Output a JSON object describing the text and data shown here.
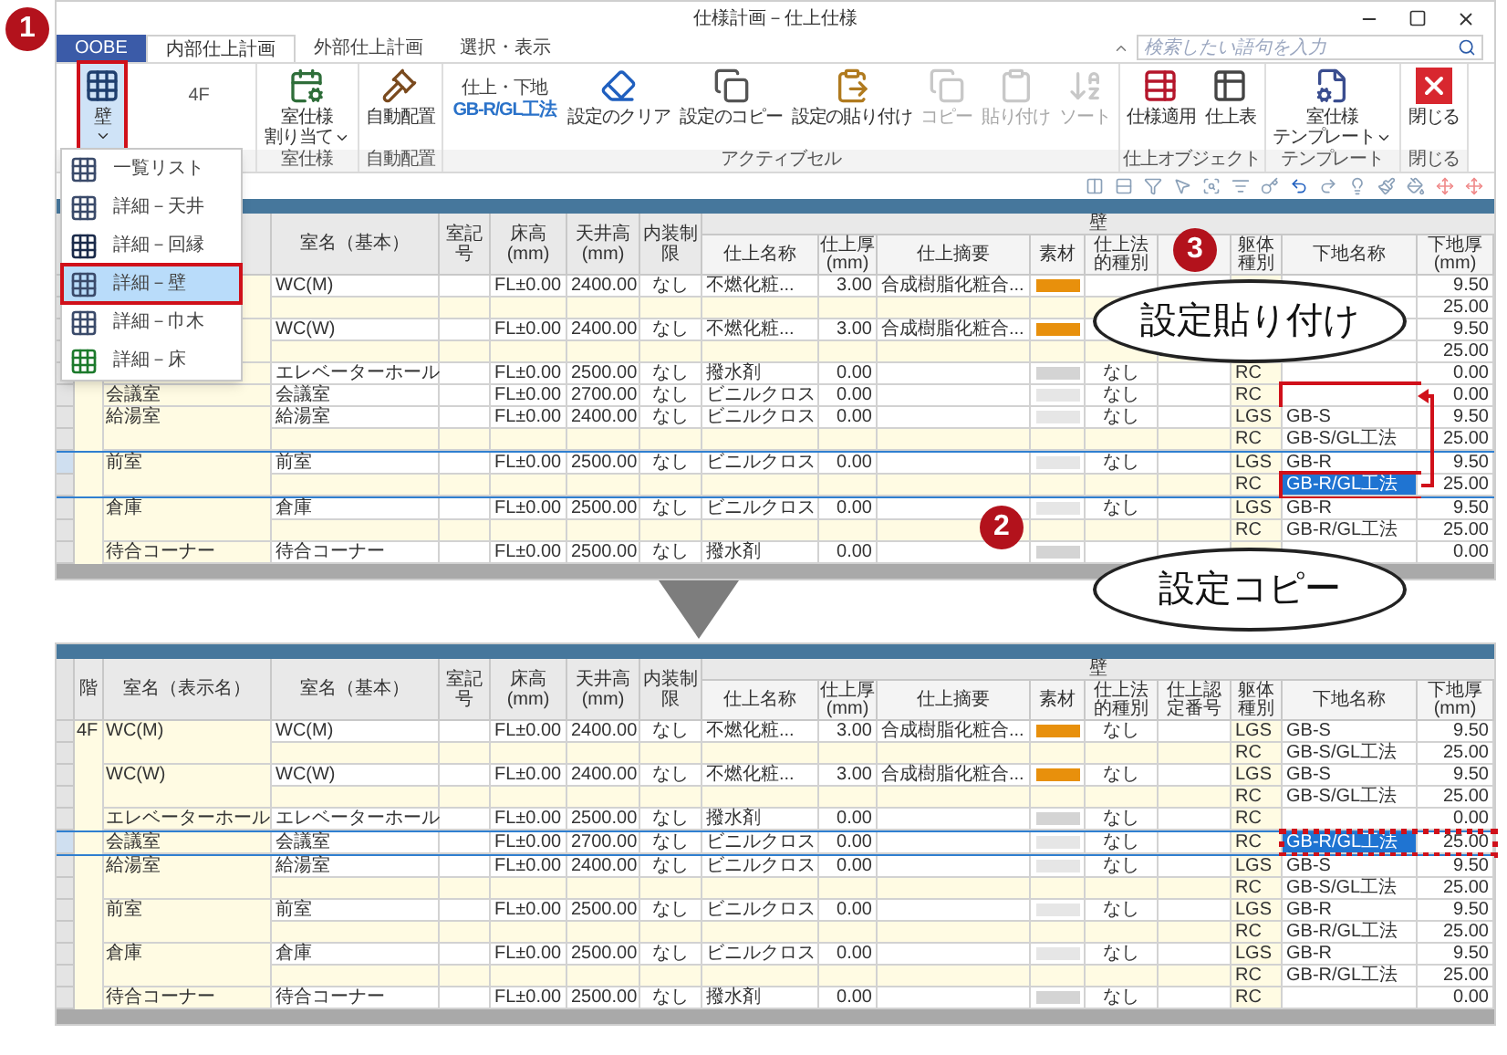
{
  "window": {
    "title": "仕様計画－仕上仕様",
    "search": {
      "placeholder": "検索したい語句を入力"
    }
  },
  "tabs": [
    {
      "label": "OOBE",
      "kind": "file",
      "selected": false
    },
    {
      "label": "内部仕上計画",
      "kind": "tab",
      "selected": true
    },
    {
      "label": "外部仕上計画",
      "kind": "tab",
      "selected": false
    },
    {
      "label": "選択・表示",
      "kind": "tab",
      "selected": false
    }
  ],
  "ribbon": {
    "groups": [
      {
        "items": [
          {
            "kind": "button",
            "lines": [
              "壁"
            ],
            "dropdown": true,
            "disabled": false,
            "pressed": true,
            "boxed": true
          },
          {
            "kind": "floor",
            "label": "4F"
          }
        ]
      },
      {
        "label": "室仕様",
        "items": [
          {
            "kind": "button",
            "lines": [
              "室仕様",
              "割り当て"
            ],
            "dropdown": true,
            "disabled": false,
            "pressed": false
          }
        ]
      },
      {
        "label": "自動配置",
        "items": [
          {
            "kind": "button",
            "lines": [
              "自動配置"
            ],
            "dropdown": false,
            "disabled": false,
            "pressed": false
          }
        ]
      },
      {
        "label": "アクティブセル",
        "items": [
          {
            "kind": "finish",
            "label": "仕上・下地",
            "value": "GB-R/GL工法"
          },
          {
            "kind": "button",
            "lines": [
              "設定のクリア"
            ],
            "dropdown": false,
            "disabled": false,
            "pressed": false
          },
          {
            "kind": "button",
            "lines": [
              "設定のコピー"
            ],
            "dropdown": false,
            "disabled": false,
            "pressed": false
          },
          {
            "kind": "button",
            "lines": [
              "設定の貼り付け"
            ],
            "dropdown": false,
            "disabled": false,
            "pressed": false
          },
          {
            "kind": "button",
            "lines": [
              "コピー"
            ],
            "dropdown": false,
            "disabled": true,
            "pressed": false
          },
          {
            "kind": "button",
            "lines": [
              "貼り付け"
            ],
            "dropdown": false,
            "disabled": true,
            "pressed": false
          },
          {
            "kind": "button",
            "lines": [
              "ソート"
            ],
            "dropdown": false,
            "disabled": true,
            "pressed": false
          }
        ]
      },
      {
        "label": "仕上オブジェクト",
        "items": [
          {
            "kind": "button",
            "lines": [
              "仕様適用"
            ],
            "dropdown": false,
            "disabled": false,
            "pressed": false
          },
          {
            "kind": "button",
            "lines": [
              "仕上表"
            ],
            "dropdown": false,
            "disabled": false,
            "pressed": false
          }
        ]
      },
      {
        "label": "テンプレート",
        "items": [
          {
            "kind": "button",
            "lines": [
              "室仕様",
              "テンプレート"
            ],
            "dropdown": true,
            "disabled": false,
            "pressed": false
          }
        ]
      },
      {
        "label": "閉じる",
        "items": [
          {
            "kind": "button",
            "lines": [
              "閉じる"
            ],
            "dropdown": false,
            "disabled": false,
            "pressed": false
          }
        ]
      }
    ]
  },
  "menu": {
    "items": [
      {
        "label": "一覧リスト",
        "selected": false
      },
      {
        "label": "詳細－天井",
        "selected": false
      },
      {
        "label": "詳細－回縁",
        "selected": false
      },
      {
        "label": "詳細－壁",
        "selected": true,
        "boxed": true
      },
      {
        "label": "詳細－巾木",
        "selected": false
      },
      {
        "label": "詳細－床",
        "selected": false
      }
    ]
  },
  "callouts": [
    {
      "number": "1"
    },
    {
      "number": "3",
      "text": "設定貼り付け"
    },
    {
      "number": "2",
      "text": "設定コピー"
    }
  ],
  "tables": [
    {
      "group_header": "壁",
      "columns": [
        null,
        null,
        "室名（基本）",
        "室記号",
        "床高(mm)",
        "天井高(mm)",
        "内装制限",
        "仕上名称",
        "仕上厚(mm)",
        "仕上摘要",
        "素材",
        "仕上法的種別",
        null,
        "躯体種別",
        "下地名称",
        "下地厚(mm)"
      ],
      "rooms": [
        {
          "base": "WC(M)",
          "floor_h": "FL±0.00",
          "ceiling": "2400.00",
          "limit": "なし",
          "finish": "不燃化粧...",
          "thick": "3.00",
          "summary": "合成樹脂化粧合...",
          "color": "#e8900c",
          "selected": false,
          "layers": [
            {
              "thick": "9.50",
              "selected": false
            },
            {
              "thick": "25.00",
              "selected": false
            }
          ]
        },
        {
          "base": "WC(W)",
          "floor_h": "FL±0.00",
          "ceiling": "2400.00",
          "limit": "なし",
          "finish": "不燃化粧...",
          "thick": "3.00",
          "summary": "合成樹脂化粧合...",
          "color": "#e8900c",
          "selected": false,
          "layers": [
            {
              "thick": "9.50",
              "selected": false
            },
            {
              "thick": "25.00",
              "selected": false
            }
          ]
        },
        {
          "base": "エレベーターホール",
          "floor_h": "FL±0.00",
          "ceiling": "2500.00",
          "limit": "なし",
          "finish": "撥水剤",
          "thick": "0.00",
          "color": "#d4d4d4",
          "legal": "なし",
          "selected": false,
          "layers": [
            {
              "frame": "RC",
              "thick": "0.00",
              "selected": false
            }
          ]
        },
        {
          "display": "会議室",
          "base": "会議室",
          "floor_h": "FL±0.00",
          "ceiling": "2700.00",
          "limit": "なし",
          "finish": "ビニルクロス",
          "thick": "0.00",
          "color": "#e6e6e6",
          "legal": "なし",
          "selected": false,
          "layers": [
            {
              "frame": "RC",
              "thick": "0.00",
              "selected": false,
              "boxed": true
            }
          ]
        },
        {
          "display": "給湯室",
          "base": "給湯室",
          "floor_h": "FL±0.00",
          "ceiling": "2400.00",
          "limit": "なし",
          "finish": "ビニルクロス",
          "thick": "0.00",
          "color": "#e6e6e6",
          "legal": "なし",
          "selected": false,
          "layers": [
            {
              "frame": "LGS",
              "name": "GB-S",
              "thick": "9.50",
              "selected": false
            },
            {
              "frame": "RC",
              "name": "GB-S/GL工法",
              "thick": "25.00",
              "selected": false
            }
          ]
        },
        {
          "display": "前室",
          "base": "前室",
          "floor_h": "FL±0.00",
          "ceiling": "2500.00",
          "limit": "なし",
          "finish": "ビニルクロス",
          "thick": "0.00",
          "color": "#e6e6e6",
          "legal": "なし",
          "selected": true,
          "layers": [
            {
              "frame": "LGS",
              "name": "GB-R",
              "thick": "9.50",
              "selected": false
            },
            {
              "frame": "RC",
              "name": "GB-R/GL工法",
              "thick": "25.00",
              "selected": true,
              "boxed": true
            }
          ]
        },
        {
          "display": "倉庫",
          "base": "倉庫",
          "floor_h": "FL±0.00",
          "ceiling": "2500.00",
          "limit": "なし",
          "finish": "ビニルクロス",
          "thick": "0.00",
          "color": "#e6e6e6",
          "legal": "なし",
          "selected": false,
          "layers": [
            {
              "frame": "LGS",
              "name": "GB-R",
              "thick": "9.50",
              "selected": false
            },
            {
              "frame": "RC",
              "name": "GB-R/GL工法",
              "thick": "25.00",
              "selected": false
            }
          ]
        },
        {
          "display": "待合コーナー",
          "base": "待合コーナー",
          "floor_h": "FL±0.00",
          "ceiling": "2500.00",
          "limit": "なし",
          "finish": "撥水剤",
          "thick": "0.00",
          "color": "#d4d4d4",
          "selected": false,
          "layers": [
            {
              "thick": "0.00",
              "selected": false
            }
          ]
        }
      ]
    },
    {
      "group_header": "壁",
      "columns": [
        "階",
        "室名（表示名）",
        "室名（基本）",
        "室記号",
        "床高(mm)",
        "天井高(mm)",
        "内装制限",
        "仕上名称",
        "仕上厚(mm)",
        "仕上摘要",
        "素材",
        "仕上法的種別",
        "仕上認定番号",
        "躯体種別",
        "下地名称",
        "下地厚(mm)"
      ],
      "rooms": [
        {
          "floor": "4F",
          "display": "WC(M)",
          "base": "WC(M)",
          "floor_h": "FL±0.00",
          "ceiling": "2400.00",
          "limit": "なし",
          "finish": "不燃化粧...",
          "thick": "3.00",
          "summary": "合成樹脂化粧合...",
          "color": "#e8900c",
          "legal": "なし",
          "selected": false,
          "layers": [
            {
              "frame": "LGS",
              "name": "GB-S",
              "thick": "9.50",
              "selected": false
            },
            {
              "frame": "RC",
              "name": "GB-S/GL工法",
              "thick": "25.00",
              "selected": false
            }
          ]
        },
        {
          "display": "WC(W)",
          "base": "WC(W)",
          "floor_h": "FL±0.00",
          "ceiling": "2400.00",
          "limit": "なし",
          "finish": "不燃化粧...",
          "thick": "3.00",
          "summary": "合成樹脂化粧合...",
          "color": "#e8900c",
          "legal": "なし",
          "selected": false,
          "layers": [
            {
              "frame": "LGS",
              "name": "GB-S",
              "thick": "9.50",
              "selected": false
            },
            {
              "frame": "RC",
              "name": "GB-S/GL工法",
              "thick": "25.00",
              "selected": false
            }
          ]
        },
        {
          "display": "エレベーターホール",
          "base": "エレベーターホール",
          "floor_h": "FL±0.00",
          "ceiling": "2500.00",
          "limit": "なし",
          "finish": "撥水剤",
          "thick": "0.00",
          "color": "#d4d4d4",
          "legal": "なし",
          "selected": false,
          "layers": [
            {
              "frame": "RC",
              "thick": "0.00",
              "selected": false
            }
          ]
        },
        {
          "display": "会議室",
          "base": "会議室",
          "floor_h": "FL±0.00",
          "ceiling": "2700.00",
          "limit": "なし",
          "finish": "ビニルクロス",
          "thick": "0.00",
          "color": "#e6e6e6",
          "legal": "なし",
          "selected": true,
          "layers": [
            {
              "frame": "RC",
              "name": "GB-R/GL工法",
              "thick": "25.00",
              "selected": true,
              "dotted_box": true
            }
          ]
        },
        {
          "display": "給湯室",
          "base": "給湯室",
          "floor_h": "FL±0.00",
          "ceiling": "2400.00",
          "limit": "なし",
          "finish": "ビニルクロス",
          "thick": "0.00",
          "color": "#e6e6e6",
          "legal": "なし",
          "selected": false,
          "layers": [
            {
              "frame": "LGS",
              "name": "GB-S",
              "thick": "9.50",
              "selected": false
            },
            {
              "frame": "RC",
              "name": "GB-S/GL工法",
              "thick": "25.00",
              "selected": false
            }
          ]
        },
        {
          "display": "前室",
          "base": "前室",
          "floor_h": "FL±0.00",
          "ceiling": "2500.00",
          "limit": "なし",
          "finish": "ビニルクロス",
          "thick": "0.00",
          "color": "#e6e6e6",
          "legal": "なし",
          "selected": false,
          "layers": [
            {
              "frame": "LGS",
              "name": "GB-R",
              "thick": "9.50",
              "selected": false
            },
            {
              "frame": "RC",
              "name": "GB-R/GL工法",
              "thick": "25.00",
              "selected": false
            }
          ]
        },
        {
          "display": "倉庫",
          "base": "倉庫",
          "floor_h": "FL±0.00",
          "ceiling": "2500.00",
          "limit": "なし",
          "finish": "ビニルクロス",
          "thick": "0.00",
          "color": "#e6e6e6",
          "legal": "なし",
          "selected": false,
          "layers": [
            {
              "frame": "LGS",
              "name": "GB-R",
              "thick": "9.50",
              "selected": false
            },
            {
              "frame": "RC",
              "name": "GB-R/GL工法",
              "thick": "25.00",
              "selected": false
            }
          ]
        },
        {
          "display": "待合コーナー",
          "base": "待合コーナー",
          "floor_h": "FL±0.00",
          "ceiling": "2500.00",
          "limit": "なし",
          "finish": "撥水剤",
          "thick": "0.00",
          "color": "#d4d4d4",
          "legal": "なし",
          "selected": false,
          "layers": [
            {
              "frame": "RC",
              "thick": "0.00",
              "selected": false
            }
          ]
        }
      ]
    }
  ]
}
